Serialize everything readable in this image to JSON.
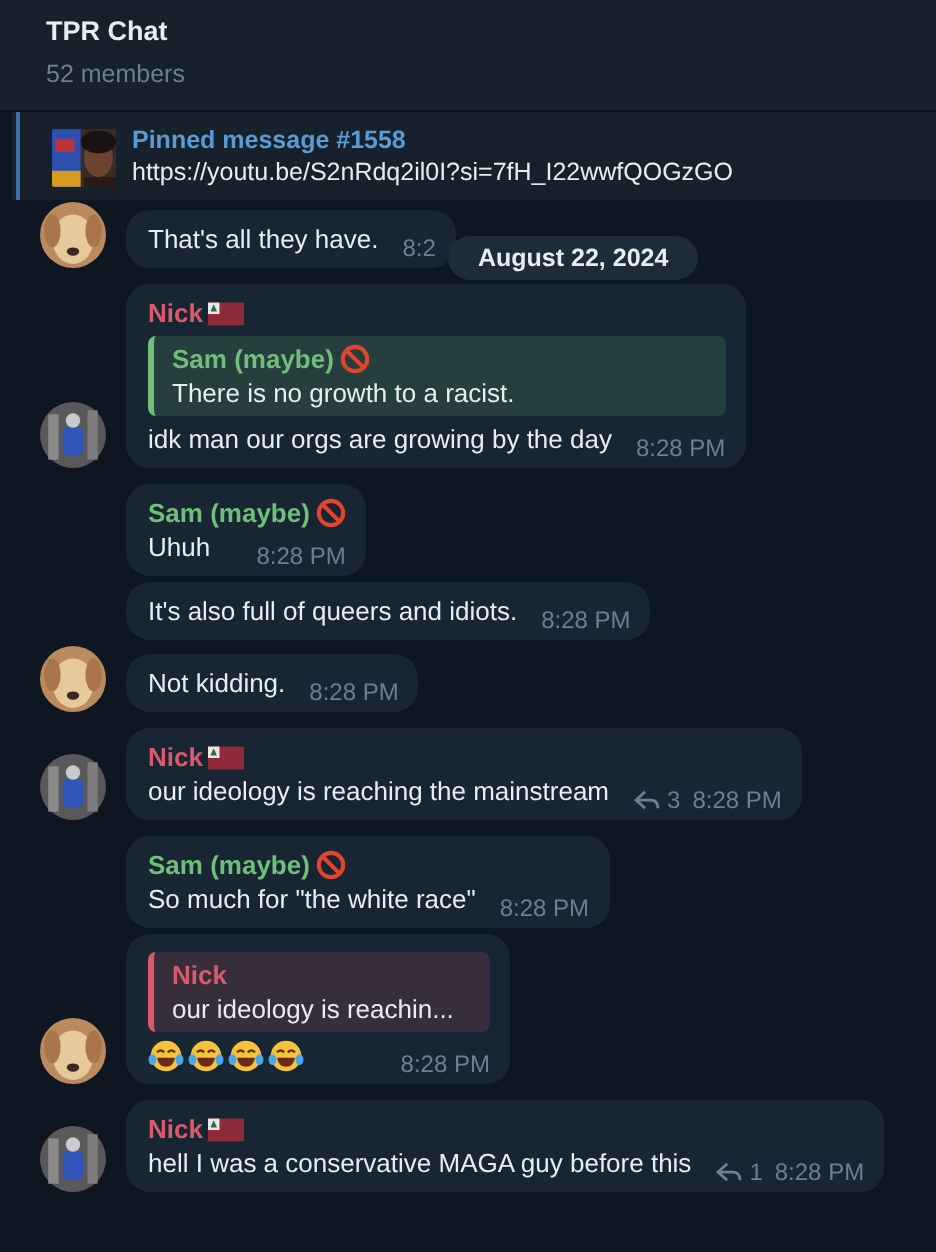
{
  "header": {
    "title": "TPR Chat",
    "subtitle": "52 members"
  },
  "pinned": {
    "title": "Pinned message #1558",
    "text": "https://youtu.be/S2nRdq2il0I?si=7fH_I22wwfQOGzGO"
  },
  "date_pill": "August 22, 2024",
  "messages": [
    {
      "text": "That's all they have.",
      "time": "8:2",
      "avatar": {
        "kind": "dog"
      }
    },
    {
      "sender": {
        "name": "Nick",
        "color": "#d95a6c",
        "badge": {
          "kind": "flag"
        }
      },
      "reply": {
        "name": "Sam (maybe)",
        "badge": {
          "kind": "ban"
        },
        "color": "#6fbf78",
        "text": "There is no growth to a racist."
      },
      "text": "idk man our orgs are growing by the day",
      "time": "8:28 PM",
      "avatar": {
        "kind": "figure"
      }
    },
    {
      "sender": {
        "name": "Sam (maybe)",
        "color": "#6fbf78",
        "badge": {
          "kind": "ban"
        }
      },
      "text": "Uhuh",
      "time": "8:28 PM"
    },
    {
      "text": "It's also full of queers and idiots.",
      "time": "8:28 PM"
    },
    {
      "text": "Not kidding.",
      "time": "8:28 PM",
      "avatar": {
        "kind": "dog"
      }
    },
    {
      "sender": {
        "name": "Nick",
        "color": "#d95a6c",
        "badge": {
          "kind": "flag"
        }
      },
      "text": "our ideology is reaching the mainstream",
      "replies": "3",
      "time": "8:28 PM",
      "avatar": {
        "kind": "figure"
      }
    },
    {
      "sender": {
        "name": "Sam (maybe)",
        "color": "#6fbf78",
        "badge": {
          "kind": "ban"
        }
      },
      "text": "So much for \"the white race\"",
      "time": "8:28 PM"
    },
    {
      "reply": {
        "name": "Nick",
        "color": "#d95a6c",
        "text": "our ideology is reachin..."
      },
      "emojis": [
        {
          "kind": "tears-of-joy"
        },
        {
          "kind": "tears-of-joy"
        },
        {
          "kind": "tears-of-joy"
        },
        {
          "kind": "tears-of-joy"
        }
      ],
      "time": "8:28 PM",
      "avatar": {
        "kind": "dog"
      }
    },
    {
      "sender": {
        "name": "Nick",
        "color": "#d95a6c",
        "badge": {
          "kind": "flag"
        }
      },
      "text": "hell I was a conservative MAGA guy before this",
      "replies": "1",
      "time": "8:28 PM",
      "avatar": {
        "kind": "figure"
      }
    }
  ]
}
